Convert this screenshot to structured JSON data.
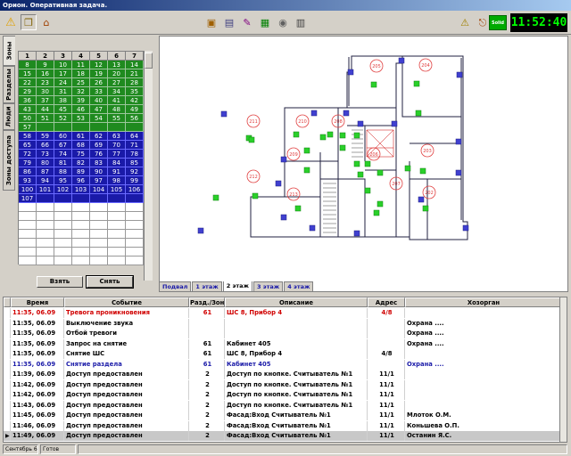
{
  "window": {
    "title": "Орион. Оперативная задача."
  },
  "toolbar": {
    "left_icons": [
      "warning-icon",
      "book-icon",
      "home-icon"
    ],
    "right_icons": [
      "card-icon",
      "monitor-icon",
      "pencil-icon",
      "grid-icon",
      "speaker-icon",
      "panel-icon",
      "door-icon",
      "exit-icon"
    ],
    "solid_label": "Solid",
    "clock": "11:52:40"
  },
  "left_tabs": [
    "Зоны",
    "Разделы",
    "Люди",
    "Зоны доступа"
  ],
  "zones": {
    "headers": [
      "1",
      "2",
      "3",
      "4",
      "5",
      "6",
      "7"
    ],
    "green": [
      "8",
      "9",
      "10",
      "11",
      "12",
      "13",
      "14",
      "15",
      "16",
      "17",
      "18",
      "19",
      "20",
      "21",
      "22",
      "23",
      "24",
      "25",
      "26",
      "27",
      "28",
      "29",
      "30",
      "31",
      "32",
      "33",
      "34",
      "35",
      "36",
      "37",
      "38",
      "39",
      "40",
      "41",
      "42",
      "43",
      "44",
      "45",
      "46",
      "47",
      "48",
      "49",
      "50",
      "51",
      "52",
      "53",
      "54",
      "55",
      "56",
      "57"
    ],
    "blue": [
      "58",
      "59",
      "60",
      "61",
      "62",
      "63",
      "64",
      "65",
      "66",
      "67",
      "68",
      "69",
      "70",
      "71",
      "72",
      "73",
      "74",
      "75",
      "76",
      "77",
      "78",
      "79",
      "80",
      "81",
      "82",
      "83",
      "84",
      "85",
      "86",
      "87",
      "88",
      "89",
      "90",
      "91",
      "92",
      "93",
      "94",
      "95",
      "96",
      "97",
      "98",
      "99",
      "100",
      "101",
      "102",
      "103",
      "104",
      "105",
      "106",
      "107"
    ],
    "take_label": "Взять",
    "remove_label": "Снять"
  },
  "map": {
    "rooms": [
      "205",
      "204",
      "211",
      "210",
      "208",
      "209",
      "206",
      "203",
      "212",
      "213",
      "207",
      "202"
    ],
    "floor_tabs": [
      "Подвал",
      "1 этаж",
      "2 этаж",
      "3 этаж",
      "4 этаж"
    ],
    "active_floor": "2 этаж"
  },
  "events": {
    "columns": [
      "Время",
      "Событие",
      "Разд./Зона",
      "Описание",
      "Адрес",
      "Хозорган"
    ],
    "rows": [
      {
        "time": "11:35, 06.09",
        "event": "Тревога проникновения",
        "zone": "61",
        "desc": "ШС 8, Прибор 4",
        "addr": "4/8",
        "owner": "",
        "color": "red"
      },
      {
        "time": "11:35, 06.09",
        "event": "Выключение звука",
        "zone": "",
        "desc": "",
        "addr": "",
        "owner": "Охрана ....",
        "color": "blk"
      },
      {
        "time": "11:35, 06.09",
        "event": "Отбой тревоги",
        "zone": "",
        "desc": "",
        "addr": "",
        "owner": "Охрана ....",
        "color": "blk"
      },
      {
        "time": "11:35, 06.09",
        "event": "Запрос на снятие",
        "zone": "61",
        "desc": "Кабинет 405",
        "addr": "",
        "owner": "Охрана ....",
        "color": "blk"
      },
      {
        "time": "11:35, 06.09",
        "event": "Снятие ШС",
        "zone": "61",
        "desc": "ШС 8, Прибор 4",
        "addr": "4/8",
        "owner": "",
        "color": "blk"
      },
      {
        "time": "11:35, 06.09",
        "event": "Снятие раздела",
        "zone": "61",
        "desc": "Кабинет 405",
        "addr": "",
        "owner": "Охрана ....",
        "color": "blue"
      },
      {
        "time": "11:39, 06.09",
        "event": "Доступ предоставлен",
        "zone": "2",
        "desc": "Доступ по кнопке. Считыватель №1",
        "addr": "11/1",
        "owner": "",
        "color": "blk"
      },
      {
        "time": "11:42, 06.09",
        "event": "Доступ предоставлен",
        "zone": "2",
        "desc": "Доступ по кнопке. Считыватель №1",
        "addr": "11/1",
        "owner": "",
        "color": "blk"
      },
      {
        "time": "11:42, 06.09",
        "event": "Доступ предоставлен",
        "zone": "2",
        "desc": "Доступ по кнопке. Считыватель №1",
        "addr": "11/1",
        "owner": "",
        "color": "blk"
      },
      {
        "time": "11:43, 06.09",
        "event": "Доступ предоставлен",
        "zone": "2",
        "desc": "Доступ по кнопке. Считыватель №1",
        "addr": "11/1",
        "owner": "",
        "color": "blk"
      },
      {
        "time": "11:45, 06.09",
        "event": "Доступ предоставлен",
        "zone": "2",
        "desc": "Фасад:Вход Считыватель №1",
        "addr": "11/1",
        "owner": "Млоток О.М.",
        "color": "blk"
      },
      {
        "time": "11:46, 06.09",
        "event": "Доступ предоставлен",
        "zone": "2",
        "desc": "Фасад:Вход Считыватель №1",
        "addr": "11/1",
        "owner": "Коньшева О.П.",
        "color": "blk"
      },
      {
        "time": "11:49, 06.09",
        "event": "Доступ предоставлен",
        "zone": "2",
        "desc": "Фасад:Вход Считыватель №1",
        "addr": "11/1",
        "owner": "Останин Я.С.",
        "color": "blk"
      }
    ]
  },
  "status": {
    "date": "Сентябрь 6",
    "state": "Готов"
  }
}
